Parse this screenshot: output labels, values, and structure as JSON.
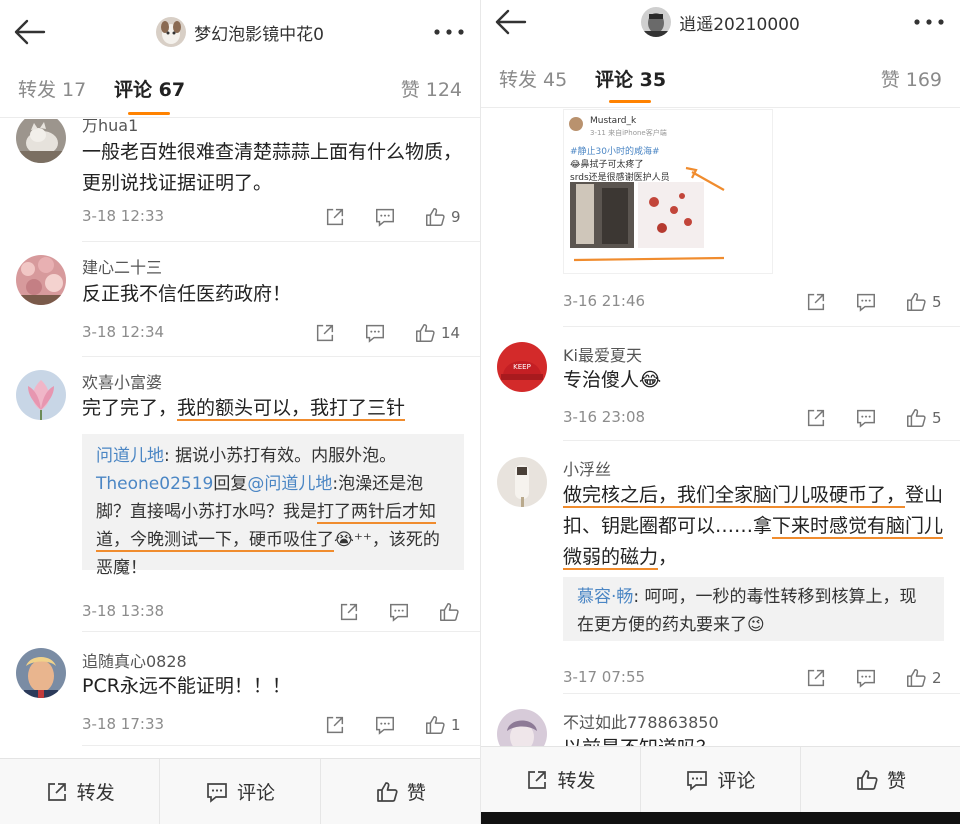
{
  "left": {
    "header": {
      "title": "梦幻泡影镜中花0"
    },
    "tabs": {
      "repost": "转发 17",
      "comment": "评论 67",
      "like": "赞 124"
    },
    "comments": [
      {
        "username": "万hua1",
        "text": "一般老百姓很难查清楚蒜蒜上面有什么物质，更别说找证据证明了。",
        "time": "3-18 12:33",
        "likes": "9"
      },
      {
        "username": "建心二十三",
        "text": "反正我不信任医药政府！",
        "time": "3-18 12:34",
        "likes": "14"
      },
      {
        "username": "欢喜小富婆",
        "text_a": "完了完了，",
        "text_b": "我的额头可以，我打了三针",
        "reply": {
          "r1_user": "问道儿地",
          "r1_text": ": 据说小苏打有效。内服外泡。",
          "r2_user": "Theone02519",
          "r2_mid": "回复",
          "r2_mention": "@问道儿地",
          "r2_text_a": ":泡澡还是泡脚？直接喝小苏打水吗？我是",
          "r2_text_b": "打了两针后才知道，",
          "r2_text_c": "今晚测试一下，",
          "r2_text_d": "硬币吸住了",
          "r2_emoji": "😭",
          "r2_text_e": "⁺⁺，该死的恶魔！"
        },
        "time": "3-18 13:38",
        "likes": ""
      },
      {
        "username": "追随真心0828",
        "text": "PCR永远不能证明！！！",
        "time": "3-18 17:33",
        "likes": "1"
      }
    ],
    "bottom": {
      "repost": "转发",
      "comment": "评论",
      "like": "赞"
    }
  },
  "right": {
    "header": {
      "title": "逍遥20210000"
    },
    "tabs": {
      "repost": "转发 45",
      "comment": "评论 35",
      "like": "赞 169"
    },
    "embed": {
      "username": "Mustard_k",
      "meta": "3-11  来自iPhone客户端",
      "hashtag": "#静止30小时的咸海#",
      "line1": "😂鼻拭子可太疼了",
      "line2": "srds还是很感谢医护人员"
    },
    "comments": [
      {
        "time": "3-16 21:46",
        "likes": "5"
      },
      {
        "username": "Ki最爱夏天",
        "text": "专治傻人",
        "emoji": "😂",
        "time": "3-16 23:08",
        "likes": "5"
      },
      {
        "username": "小浮丝",
        "text_a": "做完核之后，我们全家脑门儿吸硬币了，",
        "text_b": "登山扣、钥匙圈都可以……拿",
        "text_c": "下来时感觉有脑门儿微弱的磁力",
        "text_d": "，",
        "reply_user": "慕容·畅",
        "reply_text": ": 呵呵，一秒的毒性转移到核算上，现在更方便的药丸要来了",
        "reply_emoji": "😉",
        "time": "3-17 07:55",
        "likes": "2"
      },
      {
        "username": "不过如此778863850",
        "text": "以前是不知道吗？"
      }
    ],
    "bottom": {
      "repost": "转发",
      "comment": "评论",
      "like": "赞"
    }
  },
  "colors": {
    "accent": "#ff8200",
    "link": "#4b86c4",
    "underline": "#f08c2e"
  }
}
